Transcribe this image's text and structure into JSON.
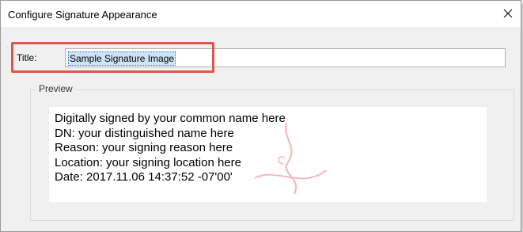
{
  "window": {
    "title": "Configure Signature Appearance",
    "close_glyph": "✕"
  },
  "title_field": {
    "label": "Title:",
    "value": "Sample Signature Image",
    "highlight_color": "#e2554a",
    "selection_color": "#cce4f7"
  },
  "preview": {
    "group_label": "Preview",
    "lines": [
      "Digitally signed by your common name here",
      "DN: your distinguished name here",
      "Reason: your signing reason here",
      "Location: your signing location here",
      "Date: 2017.11.06 14:37:52 -07'00'"
    ],
    "watermark_icon": "signature-watermark-icon",
    "watermark_color": "#f3b9b9"
  }
}
